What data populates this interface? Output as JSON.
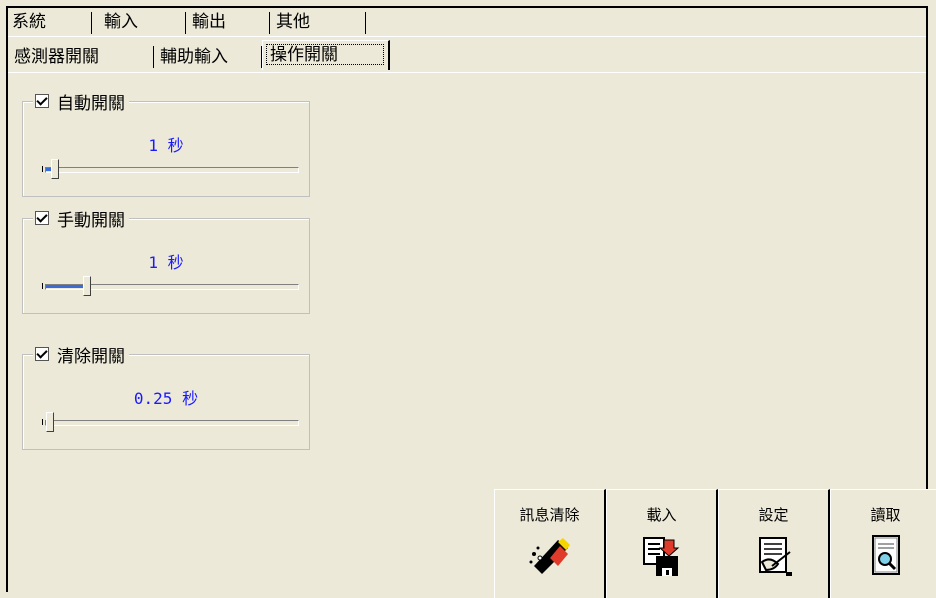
{
  "main_tabs": [
    {
      "label": "系統",
      "active": false
    },
    {
      "label": "輸入",
      "active": true
    },
    {
      "label": "輸出",
      "active": false
    },
    {
      "label": "其他",
      "active": false
    }
  ],
  "sub_tabs": [
    {
      "label": "感測器開關",
      "active": false
    },
    {
      "label": "輔助輸入",
      "active": false
    },
    {
      "label": "操作開關",
      "active": true
    }
  ],
  "groups": [
    {
      "label": "自動開關",
      "checked": true,
      "value_text": "1 秒",
      "slider_level": 0.02
    },
    {
      "label": "手動開關",
      "checked": true,
      "value_text": "1 秒",
      "slider_level": 0.15
    },
    {
      "label": "清除開關",
      "checked": true,
      "value_text": "0.25 秒",
      "slider_level": 0.0
    }
  ],
  "buttons": [
    {
      "label": "訊息清除",
      "icon": "eraser-icon"
    },
    {
      "label": "載入",
      "icon": "load-document-icon"
    },
    {
      "label": "設定",
      "icon": "write-document-icon"
    },
    {
      "label": "讀取",
      "icon": "read-document-icon"
    }
  ],
  "colors": {
    "background": "#ece9d8",
    "value_text": "#1a1aff",
    "slider_fill": "#3a6bd6"
  }
}
